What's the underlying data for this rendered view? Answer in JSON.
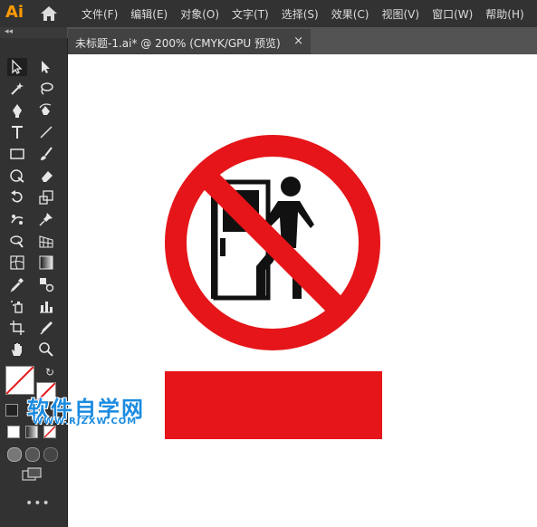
{
  "app": {
    "logo": "Ai"
  },
  "menu": {
    "items": [
      {
        "label": "文件(F)"
      },
      {
        "label": "编辑(E)"
      },
      {
        "label": "对象(O)"
      },
      {
        "label": "文字(T)"
      },
      {
        "label": "选择(S)"
      },
      {
        "label": "效果(C)"
      },
      {
        "label": "视图(V)"
      },
      {
        "label": "窗口(W)"
      },
      {
        "label": "帮助(H)"
      }
    ]
  },
  "toolbar": {
    "collapse_label": "◂◂",
    "more_label": "•••"
  },
  "document": {
    "tab_label": "未标题-1.ai* @ 200% (CMYK/GPU 预览)",
    "close_label": "×"
  },
  "watermark": {
    "title": "软件自学网",
    "url": "WWW.RJZXW.COM"
  },
  "colors": {
    "sign_red": "#e51519",
    "accent": "#ff9a00",
    "watermark_blue": "#1a8be0"
  }
}
